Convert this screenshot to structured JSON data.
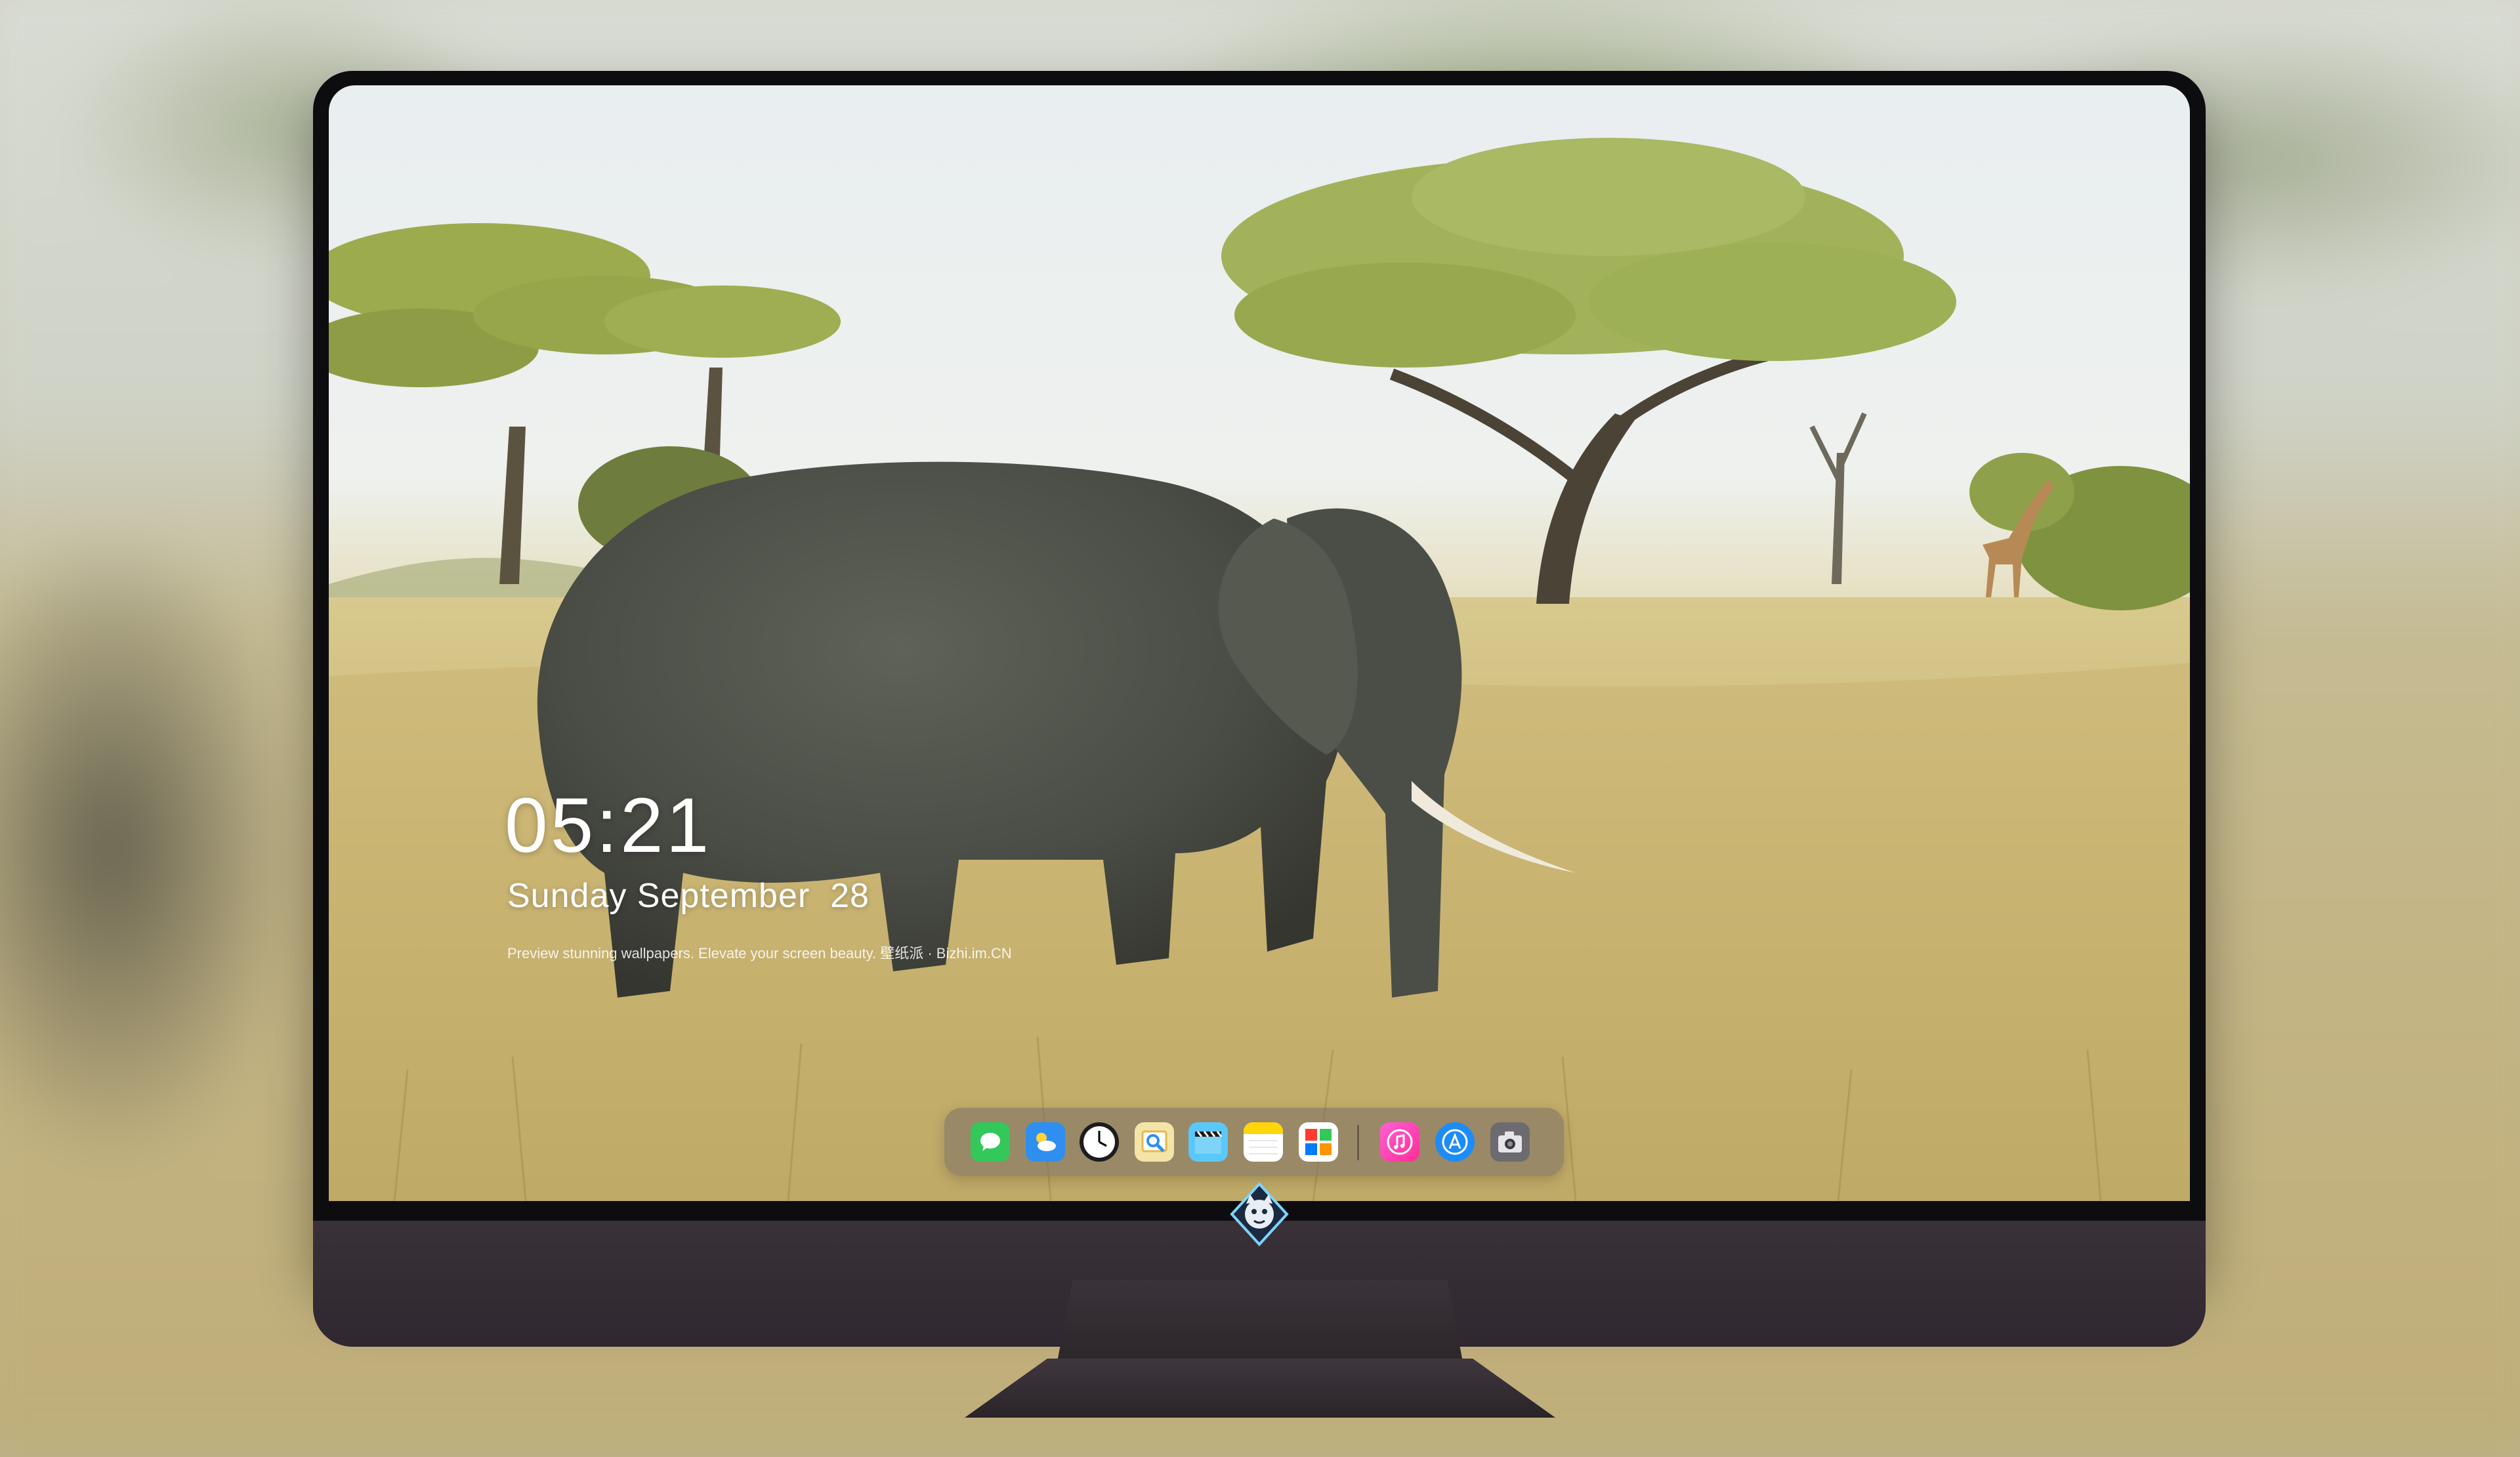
{
  "lockscreen": {
    "time": "05:21",
    "date": "Sunday September  28",
    "tagline": "Preview stunning wallpapers. Elevate your screen beauty. 壁纸派 · Bizhi.im.CN"
  },
  "wallpaper": {
    "subject": "elephant-in-savanna"
  },
  "dock": {
    "apps": [
      {
        "name": "messages-icon",
        "color": "#34c759"
      },
      {
        "name": "weather-icon",
        "color": "#2f8ff0"
      },
      {
        "name": "clock-icon",
        "color": "#1c1c1e"
      },
      {
        "name": "preview-icon",
        "color": "#f2d15c"
      },
      {
        "name": "clips-icon",
        "color": "#5ac8fa"
      },
      {
        "name": "notes-icon",
        "color": "#ffd60a"
      },
      {
        "name": "photos-grid-icon",
        "color": "#ffffff"
      },
      {
        "name": "music-icon",
        "color": "#ff4fd8"
      },
      {
        "name": "app-store-icon",
        "color": "#1d8cf8"
      },
      {
        "name": "camera-icon",
        "color": "#6c6c70"
      }
    ]
  },
  "colors": {
    "monitor_bezel": "#0d0d10",
    "monitor_chin": "#352d33",
    "dock_background": "rgba(120,110,100,0.55)"
  }
}
